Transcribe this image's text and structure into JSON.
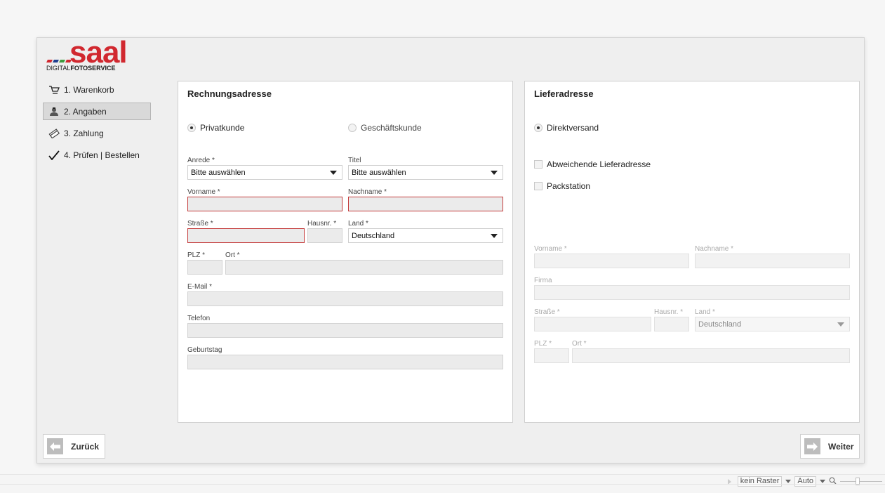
{
  "brand": {
    "name": "saal",
    "sub_light": "DIGITAL",
    "sub_bold": "FOTOSERVICE",
    "bar_colors": [
      "#d1282f",
      "#1f3f8f",
      "#3e9a3e"
    ]
  },
  "steps": [
    {
      "label": "1. Warenkorb",
      "icon": "cart-icon"
    },
    {
      "label": "2. Angaben",
      "icon": "user-icon"
    },
    {
      "label": "3. Zahlung",
      "icon": "payment-icon"
    },
    {
      "label": "4. Prüfen | Bestellen",
      "icon": "check-icon"
    }
  ],
  "billing": {
    "title": "Rechnungsadresse",
    "radio_private": "Privatkunde",
    "radio_business": "Geschäftskunde",
    "salutation_label": "Anrede *",
    "salutation_value": "Bitte auswählen",
    "title_label": "Titel",
    "title_value": "Bitte auswählen",
    "firstname_label": "Vorname *",
    "lastname_label": "Nachname *",
    "street_label": "Straße *",
    "housenr_label": "Hausnr. *",
    "country_label": "Land *",
    "country_value": "Deutschland",
    "zip_label": "PLZ *",
    "city_label": "Ort *",
    "email_label": "E-Mail *",
    "phone_label": "Telefon",
    "birthday_label": "Geburtstag"
  },
  "shipping": {
    "title": "Lieferadresse",
    "radio_direct": "Direktversand",
    "check_alt": "Abweichende Lieferadresse",
    "check_pack": "Packstation",
    "firstname_label": "Vorname *",
    "lastname_label": "Nachname *",
    "company_label": "Firma",
    "street_label": "Straße *",
    "housenr_label": "Hausnr. *",
    "country_label": "Land *",
    "country_value": "Deutschland",
    "zip_label": "PLZ *",
    "city_label": "Ort *"
  },
  "nav": {
    "back_label": "Zurück",
    "next_label": "Weiter"
  },
  "statusbar": {
    "grid_value": "kein Raster",
    "zoom_value": "Auto"
  },
  "colors": {
    "brand_red": "#d1282f",
    "error_border": "#c43c3c",
    "active_step_bg": "#d9d9d9"
  }
}
